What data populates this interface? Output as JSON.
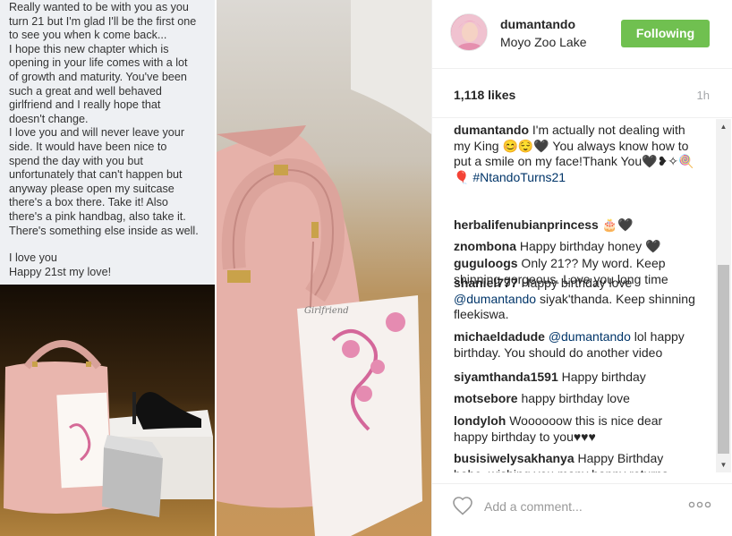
{
  "message": {
    "lines": [
      "Really wanted to be with you as you",
      "turn 21 but I'm glad I'll be the first one",
      "to see you when k come back...",
      "I hope this new chapter which is",
      "opening in your life comes with a lot",
      "of growth and maturity. You've been",
      "such a great and well behaved",
      "girlfriend and I really hope that",
      "doesn't change.",
      "I love you and will never leave your",
      "side. It would have been nice to",
      "spend the day with you but",
      "unfortunately that can't happen but",
      "anyway please open my suitcase",
      "there's a box there. Take it! Also",
      "there's a pink handbag, also take it.",
      "There's something else inside as well."
    ],
    "sign_lines": [
      "I love you",
      "Happy 21st my love!"
    ]
  },
  "photos": {
    "card_script": "Girlfriend"
  },
  "post": {
    "username": "dumantando",
    "location": "Moyo Zoo Lake",
    "follow_label": "Following",
    "likes": "1,118 likes",
    "time": "1h",
    "add_comment_placeholder": "Add a comment..."
  },
  "comments": [
    {
      "user": "dumantando",
      "parts": [
        {
          "t": "text",
          "v": " I'm actually not dealing with my King 😊😌🖤 You always know how to put a smile on my face!Thank You🖤❥✧🍭🎈 "
        },
        {
          "t": "hashtag",
          "v": "#NtandoTurns21"
        }
      ]
    },
    {
      "user": "herbalifenubianprincess",
      "parts": [
        {
          "t": "text",
          "v": " 🎂🖤"
        }
      ]
    },
    {
      "user": "znombona",
      "parts": [
        {
          "t": "text",
          "v": " Happy birthday honey 🖤"
        }
      ]
    },
    {
      "user": "guguloogs",
      "parts": [
        {
          "t": "text",
          "v": " Only 21?? My word. Keep shinning gorgeous. Love you long time"
        }
      ]
    },
    {
      "user": "shaniel777",
      "parts": [
        {
          "t": "text",
          "v": " Happy birthday love "
        },
        {
          "t": "mention",
          "v": "@dumantando"
        },
        {
          "t": "text",
          "v": " siyak'thanda. Keep shinning fleekiswa."
        }
      ]
    },
    {
      "user": "michaeldadude",
      "parts": [
        {
          "t": "text",
          "v": " "
        },
        {
          "t": "mention",
          "v": "@dumantando"
        },
        {
          "t": "text",
          "v": " lol happy birthday. You should do another video"
        }
      ]
    },
    {
      "user": "siyamthanda1591",
      "parts": [
        {
          "t": "text",
          "v": " Happy birthday"
        }
      ]
    },
    {
      "user": "motsebore",
      "parts": [
        {
          "t": "text",
          "v": " happy birthday love"
        }
      ]
    },
    {
      "user": "londyloh",
      "parts": [
        {
          "t": "text",
          "v": " Woooooow this is nice dear happy birthday to you♥♥♥"
        }
      ]
    },
    {
      "user": "busisiwelysakhanya",
      "parts": [
        {
          "t": "text",
          "v": " Happy Birthday babe, wishing you many happy returns"
        }
      ]
    }
  ],
  "icons": {
    "heart": "heart-icon",
    "more": "more-options-icon",
    "scroll_up": "scroll-up-arrow-icon",
    "scroll_down": "scroll-down-arrow-icon"
  },
  "colors": {
    "follow_button": "#70c050",
    "link": "#003569",
    "muted": "#a5a7aa"
  }
}
